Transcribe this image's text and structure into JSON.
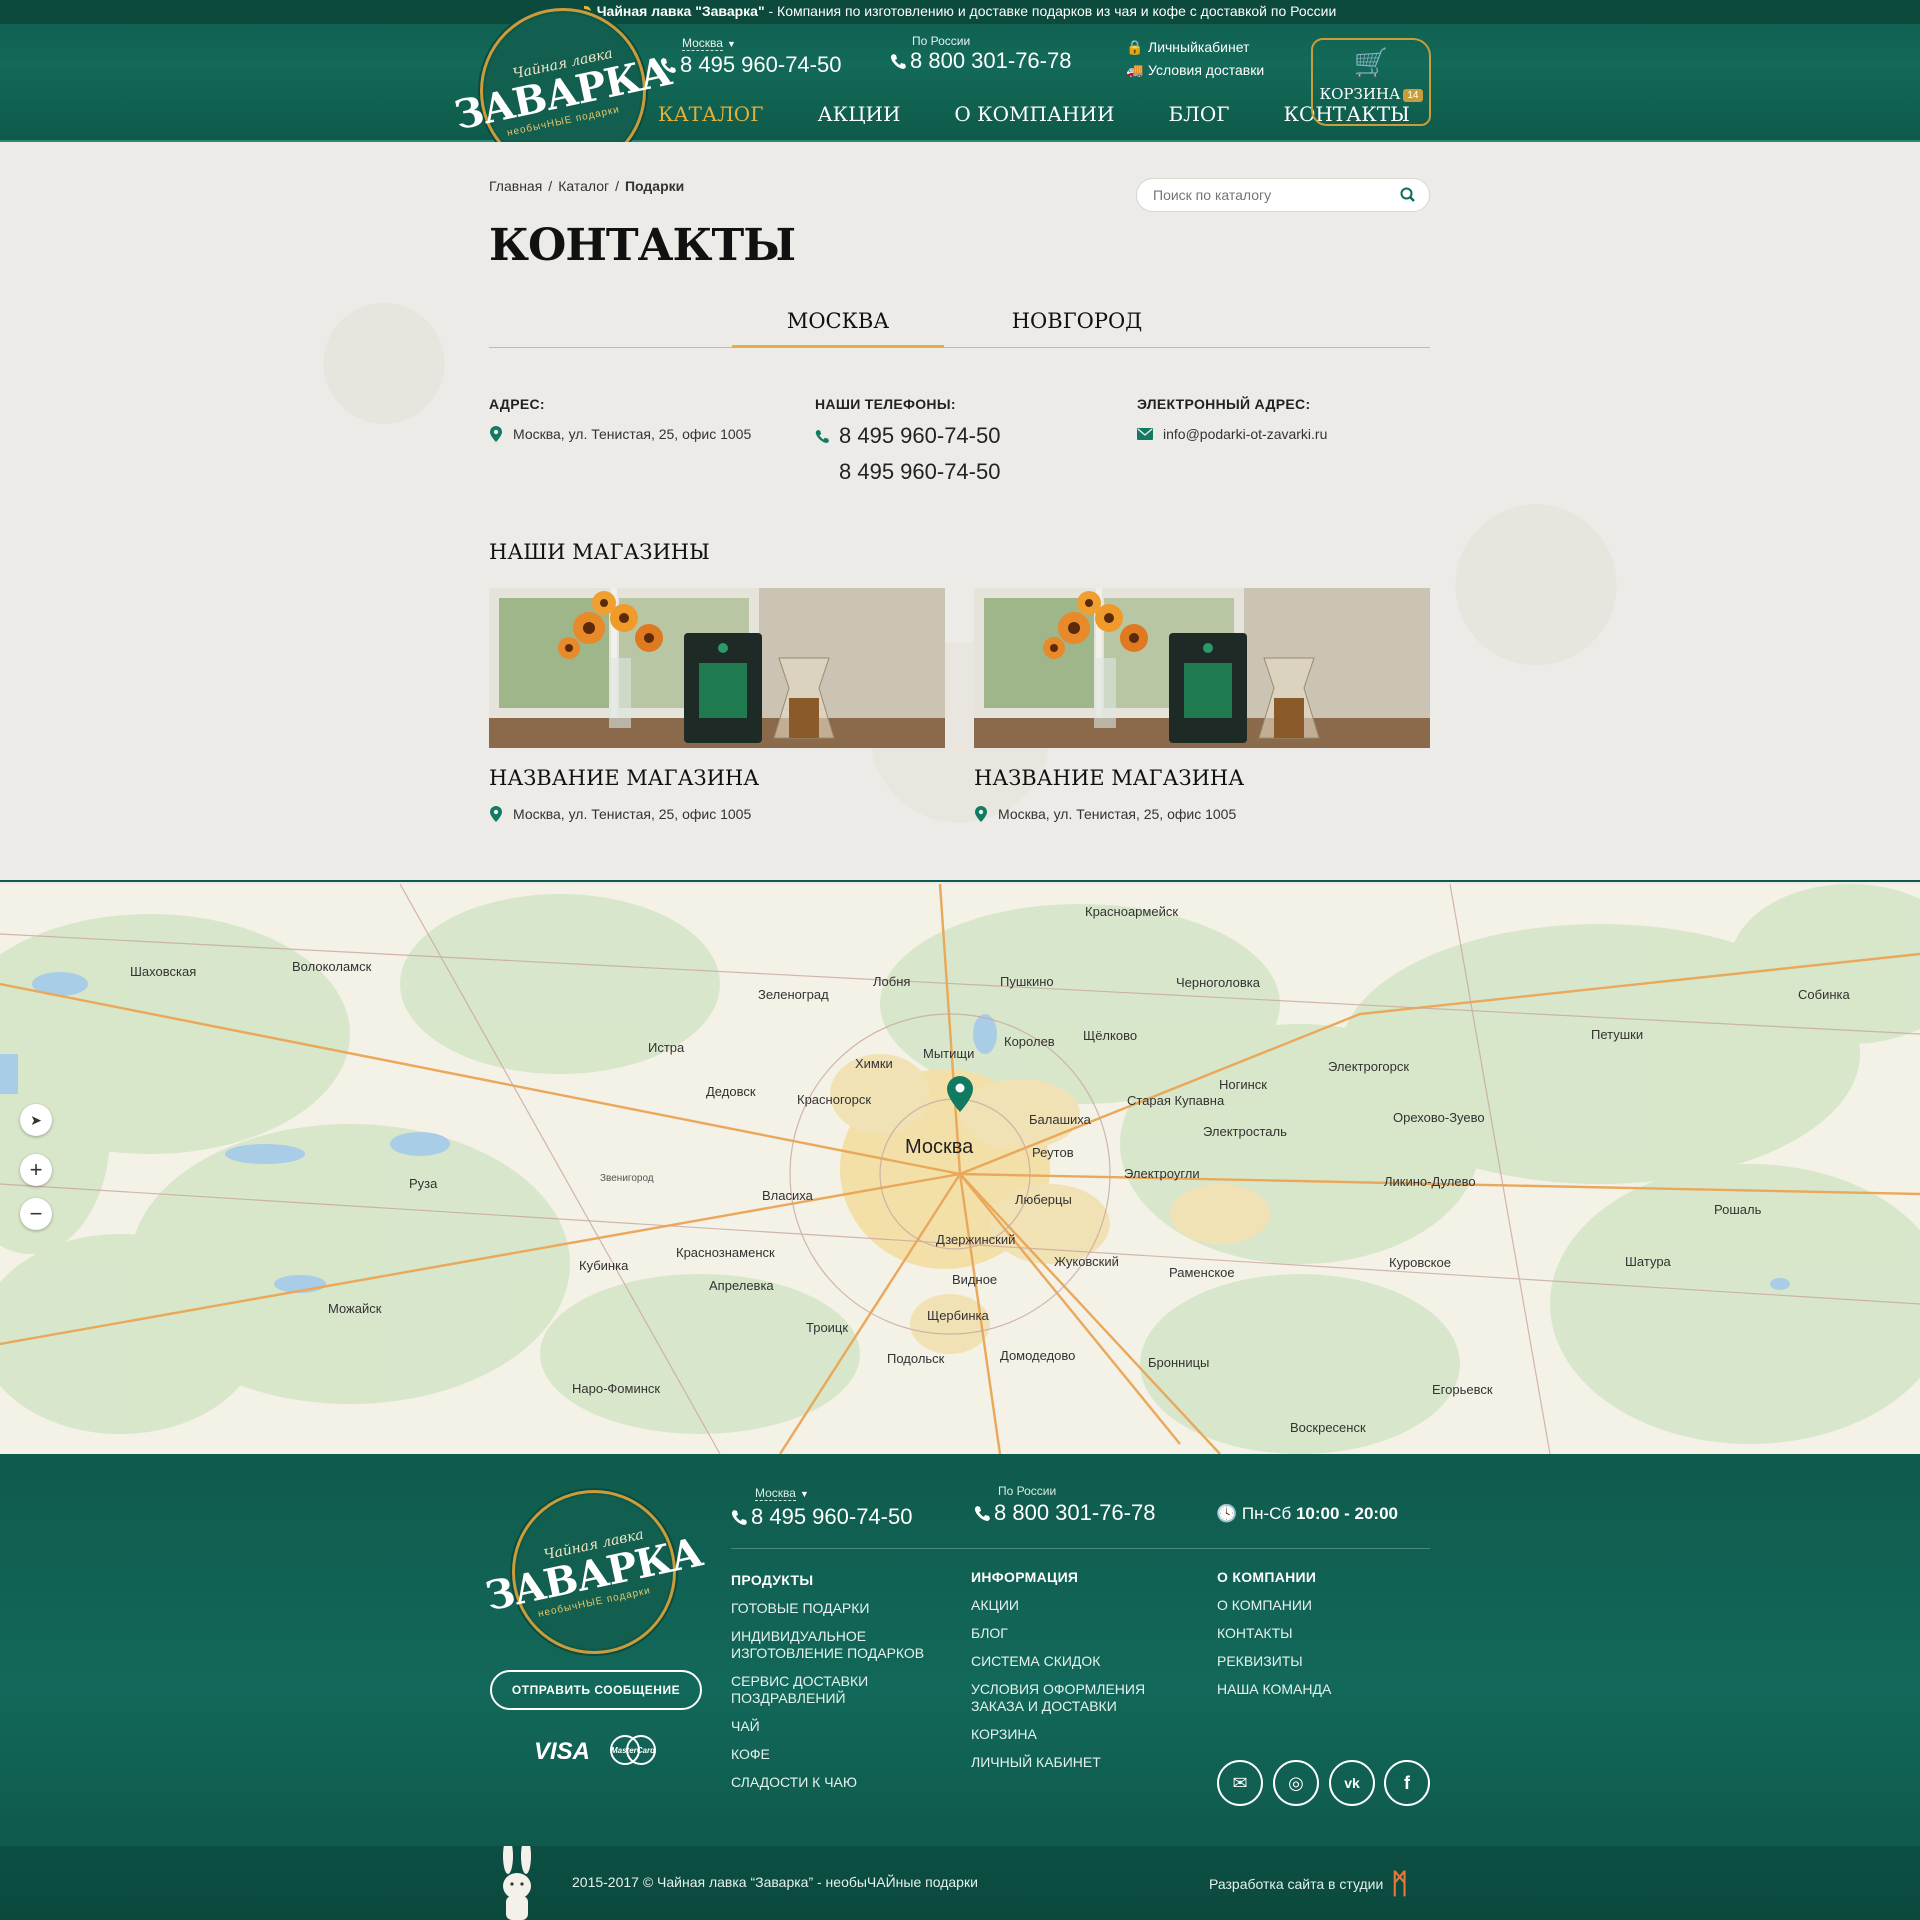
{
  "topbar": {
    "brand": "Чайная лавка \"Заварка\"",
    "text": " - Компания по изготовлению и доставке подарков из чая и кофе с доставкой по России"
  },
  "logo": {
    "line1": "Чайная лавка",
    "line2": "ЗАВАРКА",
    "line3": "необычНЫЕ подарки"
  },
  "header": {
    "phone_moscow": {
      "label": "Москва",
      "number": "8 495 960-74-50"
    },
    "phone_russia": {
      "label": "По России",
      "number": "8 800 301-76-78"
    },
    "account_link": "Личныйкабинет",
    "delivery_link": "Условия доставки",
    "nav": [
      "КАТАЛОГ",
      "АКЦИИ",
      "О КОМПАНИИ",
      "БЛОГ",
      "КОНТАКТЫ"
    ],
    "cart_label": "КОРЗИНА",
    "cart_count": "14"
  },
  "breadcrumb": {
    "home": "Главная",
    "catalog": "Каталог",
    "current": "Подарки"
  },
  "search": {
    "placeholder": "Поиск по каталогу"
  },
  "page_title": "КОНТАКТЫ",
  "tabs": [
    "МОСКВА",
    "НОВГОРОД"
  ],
  "contacts": {
    "address_title": "АДРЕС:",
    "address": "Москва, ул. Тенистая, 25, офис 1005",
    "phones_title": "НАШИ ТЕЛЕФОНЫ:",
    "phones": [
      "8 495 960-74-50",
      "8 495 960-74-50"
    ],
    "email_title": "ЭЛЕКТРОННЫЙ АДРЕС:",
    "email": "info@podarki-ot-zavarki.ru"
  },
  "stores_title": "НАШИ МАГАЗИНЫ",
  "stores": [
    {
      "name": "НАЗВАНИЕ МАГАЗИНА",
      "address": "Москва, ул. Тенистая, 25, офис 1005"
    },
    {
      "name": "НАЗВАНИЕ МАГАЗИНА",
      "address": "Москва, ул. Тенистая, 25, офис 1005"
    }
  ],
  "map": {
    "center_city": "Москва",
    "labels": [
      "Волоколамск",
      "Шаховская",
      "Истра",
      "Дедовск",
      "Красногорск",
      "Химки",
      "Мытищи",
      "Пушкино",
      "Королев",
      "Щёлково",
      "Черноголовка",
      "Ногинск",
      "Электросталь",
      "Электроугли",
      "Балашиха",
      "Реутов",
      "Люберцы",
      "Дзержинский",
      "Жуковский",
      "Раменское",
      "Видное",
      "Подольск",
      "Домодедово",
      "Бронницы",
      "Щербинка",
      "Троицк",
      "Апрелевка",
      "Краснознаменск",
      "Кубинка",
      "Можайск",
      "Руза",
      "Наро-Фоминск",
      "Власиха",
      "Зеленоград",
      "Лобня",
      "Красноармейск",
      "Петушки",
      "Собинка",
      "Орехово-Зуево",
      "Ликино-Дулево",
      "Куровское",
      "Шатура",
      "Рошаль",
      "Егорьевск",
      "Воскресенск",
      "Электрогорск",
      "Старая Купавна",
      "Звенигород"
    ],
    "controls": [
      "➤",
      "+",
      "−"
    ]
  },
  "footer": {
    "phone_moscow": {
      "label": "Москва",
      "number": "8 495 960-74-50"
    },
    "phone_russia": {
      "label": "По России",
      "number": "8 800 301-76-78"
    },
    "hours_label": "Пн-Сб",
    "hours_value": "10:00 - 20:00",
    "message_button": "ОТПРАВИТЬ СООБЩЕНИЕ",
    "payments": [
      "VISA",
      "MasterCard"
    ],
    "columns": [
      {
        "title": "ПРОДУКТЫ",
        "links": [
          "ГОТОВЫЕ ПОДАРКИ",
          "ИНДИВИДУАЛЬНОЕ ИЗГОТОВЛЕНИЕ ПОДАРКОВ",
          "СЕРВИС ДОСТАВКИ ПОЗДРАВЛЕНИЙ",
          "ЧАЙ",
          "КОФЕ",
          "СЛАДОСТИ К ЧАЮ"
        ]
      },
      {
        "title": "ИНФОРМАЦИЯ",
        "links": [
          "АКЦИИ",
          "БЛОГ",
          "СИСТЕМА СКИДОК",
          "УСЛОВИЯ ОФОРМЛЕНИЯ ЗАКАЗА И ДОСТАВКИ",
          "КОРЗИНА",
          "ЛИЧНЫЙ КАБИНЕТ"
        ]
      },
      {
        "title": "О КОМПАНИИ",
        "links": [
          "О КОМПАНИИ",
          "КОНТАКТЫ",
          "РЕКВИЗИТЫ",
          "НАША КОМАНДА"
        ]
      }
    ],
    "socials": [
      "email",
      "instagram",
      "vk",
      "facebook"
    ],
    "copyright": "2015-2017 © Чайная лавка “Заварка” - необыЧАЙные подарки",
    "studio": "Разработка сайта в студии"
  },
  "colors": {
    "brand_green": "#0f5b4c",
    "accent_gold": "#e4b03c",
    "background": "#ecebe8"
  }
}
